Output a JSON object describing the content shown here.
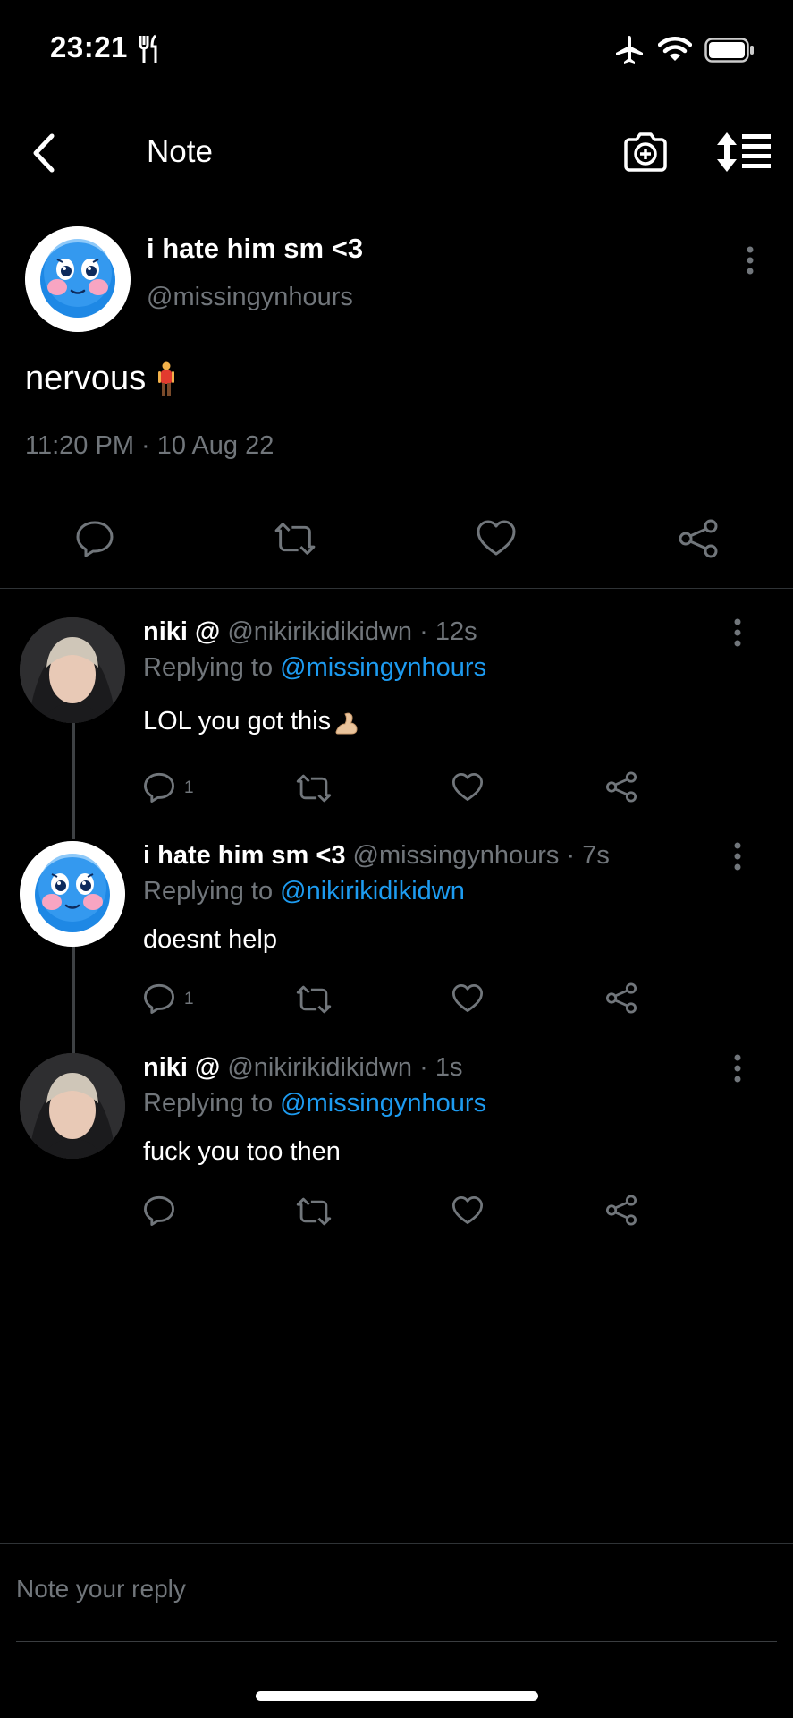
{
  "status_bar": {
    "time": "23:21"
  },
  "nav": {
    "title": "Note"
  },
  "main_post": {
    "author": "i hate him sm <3",
    "handle": "@missingynhours",
    "text": "nervous",
    "timestamp": "11:20 PM · 10 Aug 22"
  },
  "replies": [
    {
      "author": "niki @",
      "meta": " @nikirikidikidwn · 12s",
      "replying_prefix": "Replying to ",
      "mention": "@missingynhours",
      "text": "LOL you got this",
      "reply_count": "1"
    },
    {
      "author": "i hate him sm <3",
      "meta": " @missingynhours · 7s",
      "replying_prefix": "Replying to ",
      "mention": "@nikirikidikidwn",
      "text": "doesnt help",
      "reply_count": "1"
    },
    {
      "author": "niki @",
      "meta": " @nikirikidikidwn · 1s",
      "replying_prefix": "Replying to ",
      "mention": "@missingynhours",
      "text": "fuck you too then",
      "reply_count": ""
    }
  ],
  "composer": {
    "placeholder": "Note your reply"
  },
  "colors": {
    "background": "#000000",
    "accent": "#1d9bf0",
    "muted": "#71767b",
    "divider": "#2f3336"
  }
}
